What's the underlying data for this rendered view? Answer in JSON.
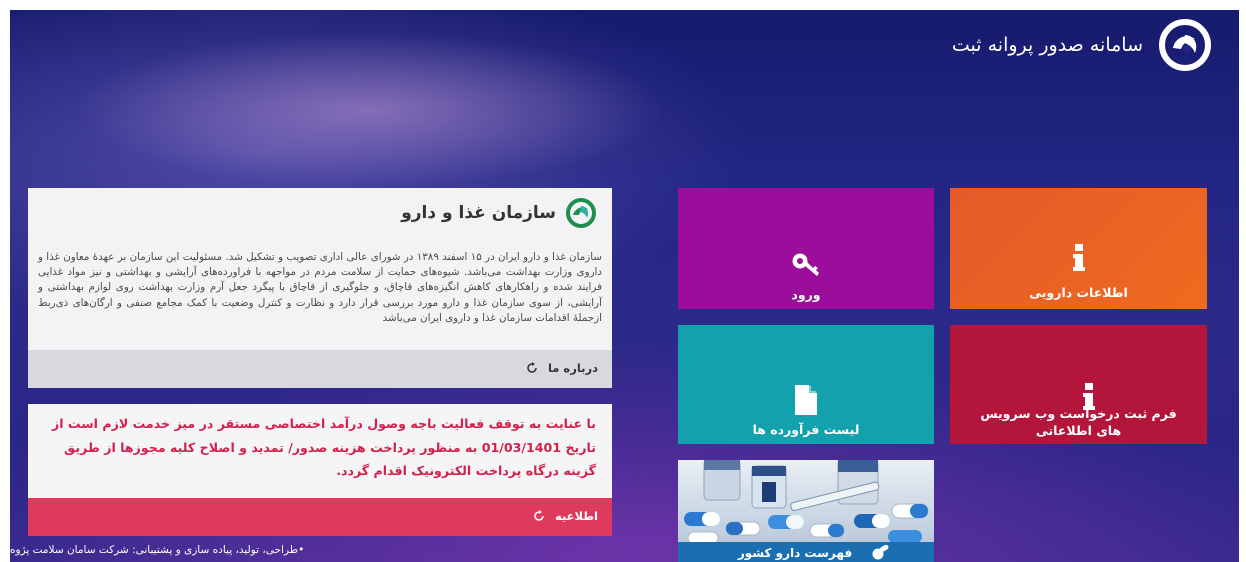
{
  "header": {
    "title": "سامانه صدور پروانه ثبت",
    "logo_icon": "fda-logo-icon"
  },
  "tiles": {
    "drug_info": {
      "label": "اطلاعات دارویی",
      "icon": "info-icon",
      "color": "#e85f26"
    },
    "login": {
      "label": "ورود",
      "icon": "key-icon",
      "color": "#9b0e9b"
    },
    "webservice": {
      "label": "فرم ثبت درخواست وب سرویس های اطلاعاتی",
      "icon": "info-icon",
      "color": "#b3153b"
    },
    "product_list": {
      "label": "لیست فرآورده ها",
      "icon": "document-icon",
      "color": "#12a1ad"
    },
    "country_drug_list": {
      "label": "فهرست دارو کشور",
      "icon": "pills-icon",
      "color": "#1b6fb0"
    }
  },
  "about": {
    "title": "سازمان غذا و دارو",
    "body": "سازمان غذا و دارو ایران در ۱۵ اسفند ۱۳۸۹ در شورای عالی اداری تصویب و تشکیل شد. مسئولیت این سازمان بر عهدهٔ معاون غذا و داروی وزارت بهداشت می‌باشد. شیوه‌های حمایت از سلامت مردم در مواجهه با فراورده‌های آرایشی و بهداشتی و نیز مواد غذایی فرایند شده و راهکارهای کاهش انگیزه‌های قاچاق، و جلوگیری از قاچاق با پیگرد جعل آرم وزارت بهداشت روی لوازم بهداشتی و آرایشی، از سوی سازمان غذا و دارو مورد بررسی قرار دارد و نظارت و کنترل وضعیت با کمک مجامع صنفی و ارگان‌های ذی‌ربط ازجملهٔ اقدامات سازمان غذا و داروی ایران می‌باشد",
    "more_label": "درباره ما"
  },
  "notice": {
    "text": "با عنایت به توقف فعالیت باجه وصول درآمد اختصاصی مستقر در میز خدمت لازم است از تاریخ 01/03/1401 به منظور پرداخت هزینه صدور/ تمدید و اصلاح کلیه مجوزها از طریق گزینه درگاه پرداخت الکترونیک اقدام گردد.",
    "more_label": "اطلاعیه"
  },
  "footer": {
    "credit": "•طراحی، تولید، پیاده سازی و پشتیبانی: شرکت سامان سلامت پژوه"
  },
  "colors": {
    "accent_red": "#d3214c",
    "notice_bar": "#de3a5e",
    "background": "#232684"
  }
}
